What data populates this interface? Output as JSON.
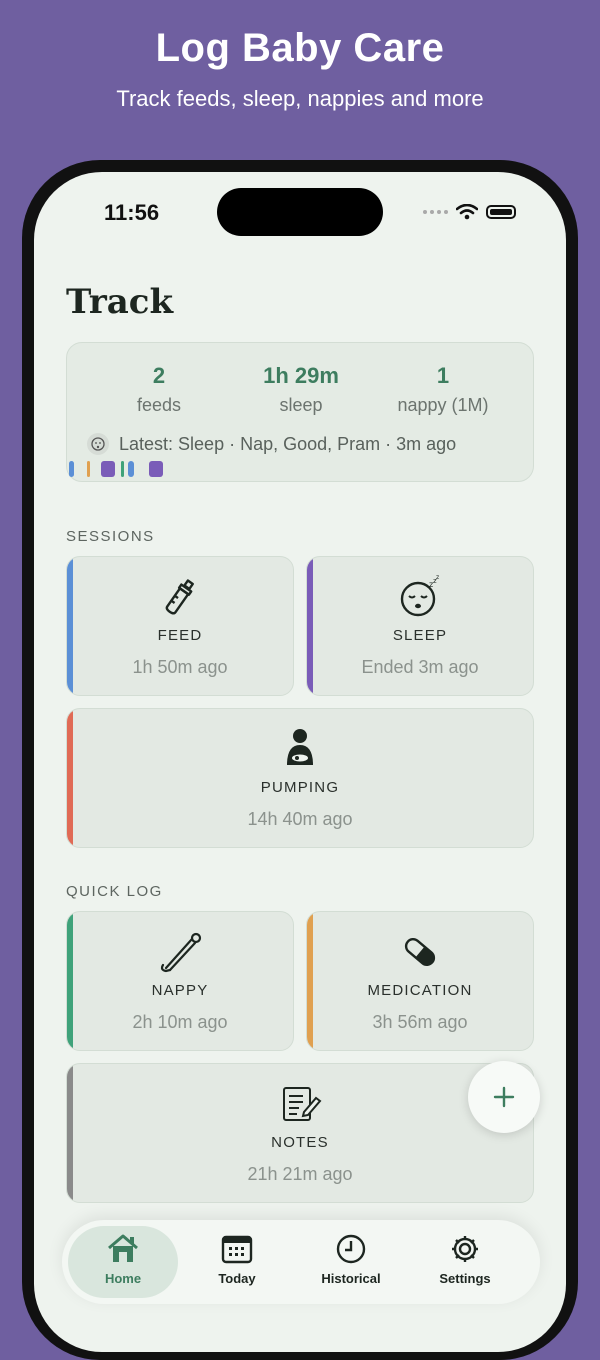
{
  "promo": {
    "title": "Log Baby Care",
    "subtitle": "Track feeds, sleep, nappies and more"
  },
  "status_bar": {
    "time": "11:56"
  },
  "page": {
    "title": "Track"
  },
  "summary": {
    "stats": [
      {
        "value": "2",
        "label": "feeds"
      },
      {
        "value": "1h 29m",
        "label": "sleep"
      },
      {
        "value": "1",
        "label": "nappy (1M)"
      }
    ],
    "latest": "Latest: Sleep · Nap, Good, Pram · 3m ago"
  },
  "sessions": {
    "label": "SESSIONS",
    "cards": [
      {
        "name": "FEED",
        "ago": "1h 50m ago",
        "icon": "bottle-icon",
        "color": "#5b8fd6"
      },
      {
        "name": "SLEEP",
        "ago": "Ended 3m ago",
        "icon": "sleep-face-icon",
        "color": "#7a5cb8"
      },
      {
        "name": "PUMPING",
        "ago": "14h 40m ago",
        "icon": "pumping-icon",
        "color": "#e06a55"
      }
    ]
  },
  "quick_log": {
    "label": "QUICK LOG",
    "cards": [
      {
        "name": "NAPPY",
        "ago": "2h 10m ago",
        "icon": "safety-pin-icon",
        "color": "#3fa27a"
      },
      {
        "name": "MEDICATION",
        "ago": "3h 56m ago",
        "icon": "pill-icon",
        "color": "#e0a050"
      },
      {
        "name": "NOTES",
        "ago": "21h 21m ago",
        "icon": "notes-icon",
        "color": "#8a8a8a"
      }
    ]
  },
  "tabbar": {
    "tabs": [
      {
        "label": "Home",
        "icon": "home-icon",
        "active": true
      },
      {
        "label": "Today",
        "icon": "calendar-icon",
        "active": false
      },
      {
        "label": "Historical",
        "icon": "clock-icon",
        "active": false
      },
      {
        "label": "Settings",
        "icon": "gear-icon",
        "active": false
      }
    ]
  },
  "colors": {
    "background": "#6f5fa0",
    "accent": "#3d7d5f",
    "feed": "#5b8fd6",
    "sleep": "#7a5cb8",
    "pumping": "#e06a55",
    "nappy": "#3fa27a",
    "medication": "#e0a050",
    "notes": "#8a8a8a"
  }
}
